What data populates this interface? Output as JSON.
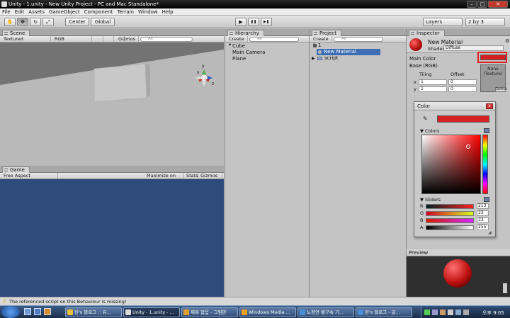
{
  "window": {
    "title": "Unity - 1.unity - New Unity Project - PC and Mac Standalone*",
    "min": "–",
    "max": "□",
    "close": "✕"
  },
  "menu": [
    "File",
    "Edit",
    "Assets",
    "GameObject",
    "Component",
    "Terrain",
    "Window",
    "Help"
  ],
  "toolbar": {
    "hand": "✋",
    "move": "✥",
    "rotate": "↻",
    "scale": "⤢",
    "center": "Center",
    "global": "Global",
    "play": "▶",
    "pause": "❚❚",
    "step": "▶❚",
    "layers": "Layers",
    "layout": "2 by 3"
  },
  "scene": {
    "tab": "Scene",
    "render_mode": "Textured",
    "color_mode": "RGB",
    "gizmos": "Gizmos ▾",
    "search": "All",
    "axis_y": "y",
    "axis_x": "x",
    "axis_z": "z"
  },
  "game": {
    "tab": "Game",
    "aspect": "Free Aspect",
    "maximize": "Maximize on Play",
    "stats": "Stats",
    "gizmos": "Gizmos ▾"
  },
  "hierarchy": {
    "tab": "Hierarchy",
    "create": "Create ▾",
    "search": "All",
    "items": [
      "Cube",
      "Main Camera",
      "Plane"
    ]
  },
  "project": {
    "tab": "Project",
    "create": "Create ▾",
    "search": "All",
    "items": [
      "1",
      "New Material",
      "script"
    ]
  },
  "inspector": {
    "tab": "Inspector",
    "material_name": "New Material",
    "shader_label": "Shader",
    "shader_value": "Diffuse",
    "main_color": "Main Color",
    "base": "Base (RGB)",
    "tiling": "Tiling",
    "offset": "Offset",
    "x": "x",
    "y": "y",
    "tiling_x": "1",
    "tiling_y": "1",
    "offset_x": "0",
    "offset_y": "0",
    "tex_none": "None",
    "tex_type": "(Texture)",
    "select": "Select",
    "accent_color": "#e02020"
  },
  "color_picker": {
    "title": "Color",
    "close": "x",
    "colors_label": "Colors",
    "sliders_label": "Sliders",
    "channels": [
      {
        "name": "R",
        "value": "213"
      },
      {
        "name": "G",
        "value": "33"
      },
      {
        "name": "B",
        "value": "33"
      },
      {
        "name": "A",
        "value": "255"
      }
    ],
    "current_color": "#d52121"
  },
  "preview": {
    "title": "Preview"
  },
  "status": {
    "message": "The referenced script on this Behaviour is missing!"
  },
  "taskbar": {
    "tasks": [
      "된's 블로그 :: 유...",
      "Unity - 1.unity - ...",
      "제목 없음 - 그림판",
      "Windows Media ...",
      "뇨정연 불구속 기...",
      "된's 블로그 - 글..."
    ],
    "clock": "오후 9:05"
  }
}
